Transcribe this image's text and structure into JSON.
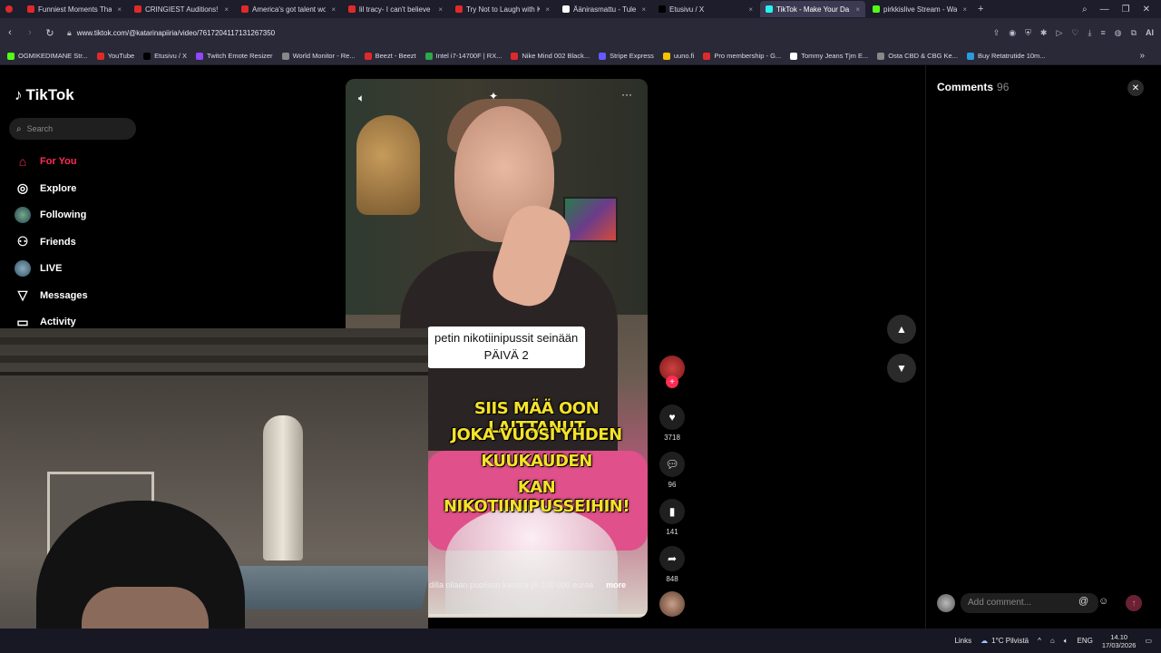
{
  "browser": {
    "tabs": [
      {
        "title": "Funniest Moments That M",
        "color": "#e02a2a",
        "active": false
      },
      {
        "title": "CRINGIEST Auditions! Try",
        "color": "#e02a2a",
        "active": false
      },
      {
        "title": "America's got talent worst",
        "color": "#e02a2a",
        "active": false
      },
      {
        "title": "lil tracy- I can't believe my",
        "color": "#e02a2a",
        "active": false
      },
      {
        "title": "Try Not to Laugh with KSI",
        "color": "#e02a2a",
        "active": false
      },
      {
        "title": "Äänirasmattu - Tule usko",
        "color": "#ffffff",
        "active": false
      },
      {
        "title": "Etusivu / X",
        "color": "#000000",
        "active": false
      },
      {
        "title": "TikTok - Make Your Da",
        "color": "#25f4ee",
        "active": true
      },
      {
        "title": "pirkkislive Stream - Watch",
        "color": "#53fc18",
        "active": false
      }
    ],
    "url": "www.tiktok.com/@katarinapiiria/video/7617204117131267350",
    "bookmarks": [
      {
        "label": "OGMIKEDIMANE Str...",
        "color": "#53fc18"
      },
      {
        "label": "YouTube",
        "color": "#e02a2a"
      },
      {
        "label": "Etusivu / X",
        "color": "#000000"
      },
      {
        "label": "Twitch Emote Resizer",
        "color": "#9146ff"
      },
      {
        "label": "World Monitor - Re...",
        "color": "#888888"
      },
      {
        "label": "Beezt - Beezt",
        "color": "#e02a2a"
      },
      {
        "label": "Intel i7-14700F | RX...",
        "color": "#2aa84a"
      },
      {
        "label": "Nike Mind 002 Black...",
        "color": "#e02a2a"
      },
      {
        "label": "Stripe Express",
        "color": "#635bff"
      },
      {
        "label": "uuno.fi",
        "color": "#f5c400"
      },
      {
        "label": "Pro membership - G...",
        "color": "#e02a2a"
      },
      {
        "label": "Tommy Jeans Tjm E...",
        "color": "#ffffff"
      },
      {
        "label": "Osta CBD & CBG Ke...",
        "color": "#888888"
      },
      {
        "label": "Buy Retatrutide 10m...",
        "color": "#2a9be0"
      }
    ]
  },
  "tiktok": {
    "logo": "TikTok",
    "search_placeholder": "Search",
    "nav": [
      {
        "label": "For You",
        "icon": "home-icon",
        "active": true
      },
      {
        "label": "Explore",
        "icon": "compass-icon",
        "active": false
      },
      {
        "label": "Following",
        "icon": "following-avatar-icon",
        "active": false
      },
      {
        "label": "Friends",
        "icon": "friends-icon",
        "active": false
      },
      {
        "label": "LIVE",
        "icon": "live-avatar-icon",
        "active": false
      },
      {
        "label": "Messages",
        "icon": "messages-icon",
        "active": false
      },
      {
        "label": "Activity",
        "icon": "activity-icon",
        "active": false
      }
    ],
    "video": {
      "caption_line1": "petin nikotiinipussit seinään",
      "caption_line2": "PÄIVÄ 2",
      "overlay_lines": [
        "SIIS MÄÄ OON LAITTANUT",
        "JOKA VUOSI YHDEN",
        "KUUKAUDEN",
        "KAN NIKOTIINIPUSSEIHIN!"
      ],
      "description": "dilla ollaan puolison kanssa yli 100 000 euroa",
      "more_label": "more",
      "progress": 0.0
    },
    "actions": {
      "likes": "3718",
      "comments": "96",
      "saves": "141",
      "shares": "848"
    },
    "comments_panel": {
      "title": "Comments",
      "count": "96",
      "input_placeholder": "Add comment..."
    }
  },
  "taskbar": {
    "links_label": "Links",
    "weather": "1°C  Pilvistä",
    "language": "ENG",
    "time": "14.10",
    "date": "17/03/2026"
  },
  "colors": {
    "accent": "#fe2c55",
    "browser_bg": "#2a2938",
    "overlay_text": "#f5e22a"
  }
}
